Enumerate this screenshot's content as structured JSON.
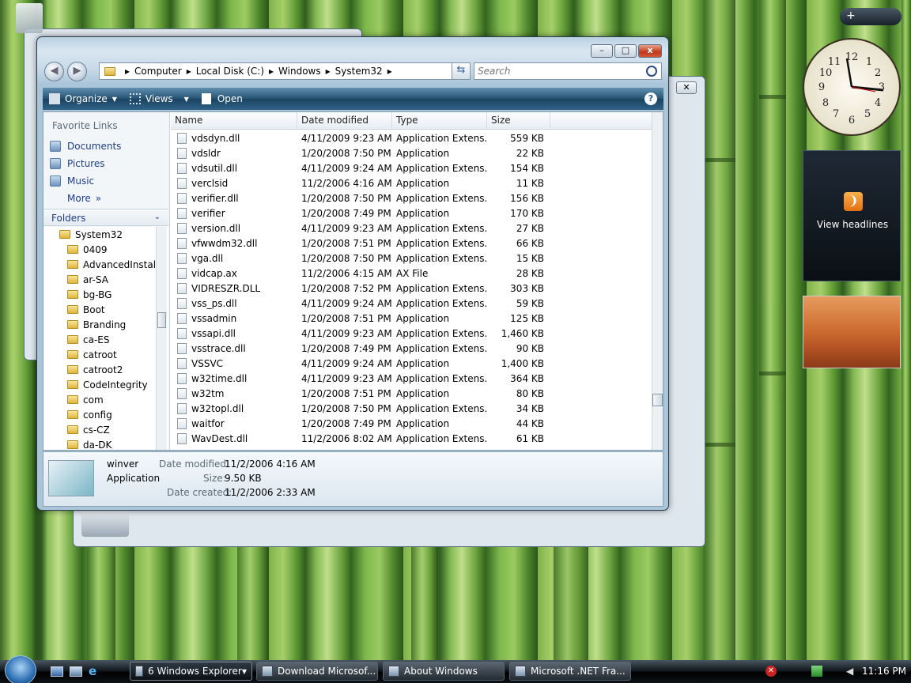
{
  "window": {
    "back_label": "◀",
    "forward_label": "▶",
    "minimize": "–",
    "maximize": "□",
    "close": "x"
  },
  "breadcrumb": [
    "Computer",
    "Local Disk (C:)",
    "Windows",
    "System32"
  ],
  "search": {
    "placeholder": "Search"
  },
  "toolbar": {
    "organize": "Organize",
    "views": "Views",
    "open": "Open",
    "help": "?"
  },
  "nav": {
    "favorite_links": "Favorite Links",
    "links": [
      "Documents",
      "Pictures",
      "Music"
    ],
    "more": "More",
    "folders": "Folders"
  },
  "tree": [
    "System32",
    "0409",
    "AdvancedInstalle",
    "ar-SA",
    "bg-BG",
    "Boot",
    "Branding",
    "ca-ES",
    "catroot",
    "catroot2",
    "CodeIntegrity",
    "com",
    "config",
    "cs-CZ",
    "da-DK"
  ],
  "columns": [
    "Name",
    "Date modified",
    "Type",
    "Size"
  ],
  "files": [
    [
      "vdsdyn.dll",
      "4/11/2009 9:23 AM",
      "Application Extens...",
      "559 KB"
    ],
    [
      "vdsldr",
      "1/20/2008 7:50 PM",
      "Application",
      "22 KB"
    ],
    [
      "vdsutil.dll",
      "4/11/2009 9:24 AM",
      "Application Extens...",
      "154 KB"
    ],
    [
      "verclsid",
      "11/2/2006 4:16 AM",
      "Application",
      "11 KB"
    ],
    [
      "verifier.dll",
      "1/20/2008 7:50 PM",
      "Application Extens...",
      "156 KB"
    ],
    [
      "verifier",
      "1/20/2008 7:49 PM",
      "Application",
      "170 KB"
    ],
    [
      "version.dll",
      "4/11/2009 9:23 AM",
      "Application Extens...",
      "27 KB"
    ],
    [
      "vfwwdm32.dll",
      "1/20/2008 7:51 PM",
      "Application Extens...",
      "66 KB"
    ],
    [
      "vga.dll",
      "1/20/2008 7:50 PM",
      "Application Extens...",
      "15 KB"
    ],
    [
      "vidcap.ax",
      "11/2/2006 4:15 AM",
      "AX File",
      "28 KB"
    ],
    [
      "VIDRESZR.DLL",
      "1/20/2008 7:52 PM",
      "Application Extens...",
      "303 KB"
    ],
    [
      "vss_ps.dll",
      "4/11/2009 9:24 AM",
      "Application Extens...",
      "59 KB"
    ],
    [
      "vssadmin",
      "1/20/2008 7:51 PM",
      "Application",
      "125 KB"
    ],
    [
      "vssapi.dll",
      "4/11/2009 9:23 AM",
      "Application Extens...",
      "1,460 KB"
    ],
    [
      "vsstrace.dll",
      "1/20/2008 7:49 PM",
      "Application Extens...",
      "90 KB"
    ],
    [
      "VSSVC",
      "4/11/2009 9:24 AM",
      "Application",
      "1,400 KB"
    ],
    [
      "w32time.dll",
      "4/11/2009 9:23 AM",
      "Application Extens...",
      "364 KB"
    ],
    [
      "w32tm",
      "1/20/2008 7:51 PM",
      "Application",
      "80 KB"
    ],
    [
      "w32topl.dll",
      "1/20/2008 7:50 PM",
      "Application Extens...",
      "34 KB"
    ],
    [
      "waitfor",
      "1/20/2008 7:49 PM",
      "Application",
      "44 KB"
    ],
    [
      "WavDest.dll",
      "11/2/2006 8:02 AM",
      "Application Extens...",
      "61 KB"
    ]
  ],
  "details": {
    "name": "winver",
    "type": "Application",
    "modified_label": "Date modified:",
    "modified": "11/2/2006 4:16 AM",
    "size_label": "Size:",
    "size": "9.50 KB",
    "created_label": "Date created:",
    "created": "11/2/2006 2:33 AM"
  },
  "sidebar_gadgets": {
    "headlines": "View headlines"
  },
  "taskbar": {
    "tasks": [
      "6 Windows Explorer",
      "Download Microsof...",
      "About Windows",
      "Microsoft .NET Fra..."
    ],
    "clock": "11:16 PM"
  }
}
